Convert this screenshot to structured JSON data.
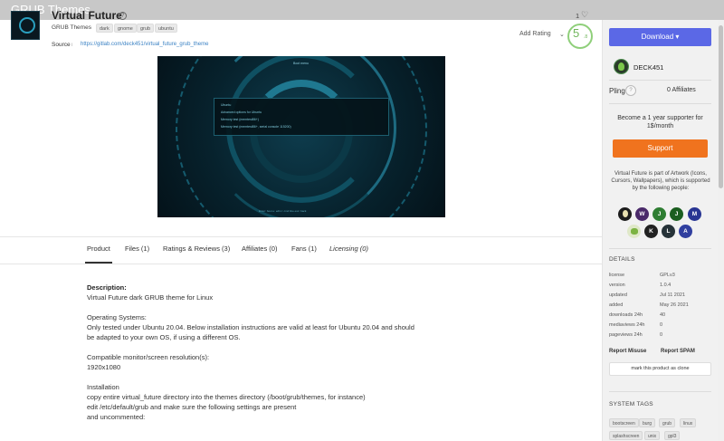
{
  "window": {
    "title": "GRUB Themes"
  },
  "product": {
    "title": "Virtual Future",
    "category": "GRUB Themes",
    "tags": [
      "dark",
      "gnome",
      "grub",
      "ubuntu"
    ],
    "source_label": "Source",
    "source_info": "i",
    "source_url": "https://gitlab.com/deck451/virtual_future_grub_theme",
    "likes": "1",
    "add_rating_label": "Add Rating",
    "rating_value": "5",
    "rating_sub": ".8"
  },
  "preview": {
    "menu_top": "Boot menu",
    "menu_lines": [
      "Ubuntu",
      "Advanced options for Ubuntu",
      "Memory test (memtest86+)",
      "Memory test (memtest86+, serial console 115200)"
    ],
    "menu_bottom": "Enter: boot   e: edit   c: cmd line   esc: back"
  },
  "tabs": [
    {
      "label": "Product",
      "active": true
    },
    {
      "label": "Files (1)"
    },
    {
      "label": "Ratings & Reviews (3)"
    },
    {
      "label": "Affiliates (0)"
    },
    {
      "label": "Fans (1)"
    },
    {
      "label": "Licensing (0)"
    }
  ],
  "description": {
    "heading": "Description:",
    "lines": [
      "Virtual Future dark GRUB theme for Linux",
      "",
      "Operating Systems:",
      "Only tested under Ubuntu 20.04. Below installation instructions are valid at least for Ubuntu 20.04 and should",
      "be adapted to your own OS, if using a different OS.",
      "",
      "Compatible monitor/screen resolution(s):",
      "1920x1080",
      "",
      "Installation",
      "copy entire virtual_future directory into the themes directory (/boot/grub/themes, for instance)",
      "edit /etc/default/grub and make sure the following settings are present",
      "and uncommented:"
    ]
  },
  "sidebar": {
    "download_label": "Download ▾",
    "username": "DECK451",
    "pling_label": "Pling",
    "pling_icon": "?",
    "affiliates": "0 Affiliates",
    "supporter_text": "Become a 1 year supporter for 1$/month",
    "support_label": "Support",
    "part_of_text": "Virtual Future is part of Artwork (Icons, Cursors, Wallpapers), which is supported by the following people:",
    "supporters": [
      {
        "letter": "",
        "color": "#1c1c1c",
        "img": true
      },
      {
        "letter": "W",
        "color": "#4a2a6a"
      },
      {
        "letter": "J",
        "color": "#2e7d32"
      },
      {
        "letter": "J",
        "color": "#1b5e20"
      },
      {
        "letter": "M",
        "color": "#283593"
      },
      {
        "letter": "",
        "color": "#7cb342",
        "img": true
      },
      {
        "letter": "K",
        "color": "#212121"
      },
      {
        "letter": "L",
        "color": "#263238"
      },
      {
        "letter": "A",
        "color": "#303f9f"
      }
    ],
    "details_heading": "DETAILS",
    "details": [
      {
        "key": "license",
        "value": "GPLv3"
      },
      {
        "key": "version",
        "value": "1.0.4"
      },
      {
        "key": "updated",
        "value": "Jul 11 2021"
      },
      {
        "key": "added",
        "value": "May 26 2021"
      },
      {
        "key": "downloads 24h",
        "value": "40"
      },
      {
        "key": "mediaviews 24h",
        "value": "0"
      },
      {
        "key": "pageviews 24h",
        "value": "0"
      }
    ],
    "report_misuse": "Report Misuse",
    "report_spam": "Report SPAM",
    "clone_label": "mark this product as clone",
    "system_tags_heading": "SYSTEM TAGS",
    "system_tags": [
      "bootscreen",
      "burg",
      "grub",
      "linux",
      "splashscreen",
      "unix",
      "gpl3"
    ]
  }
}
